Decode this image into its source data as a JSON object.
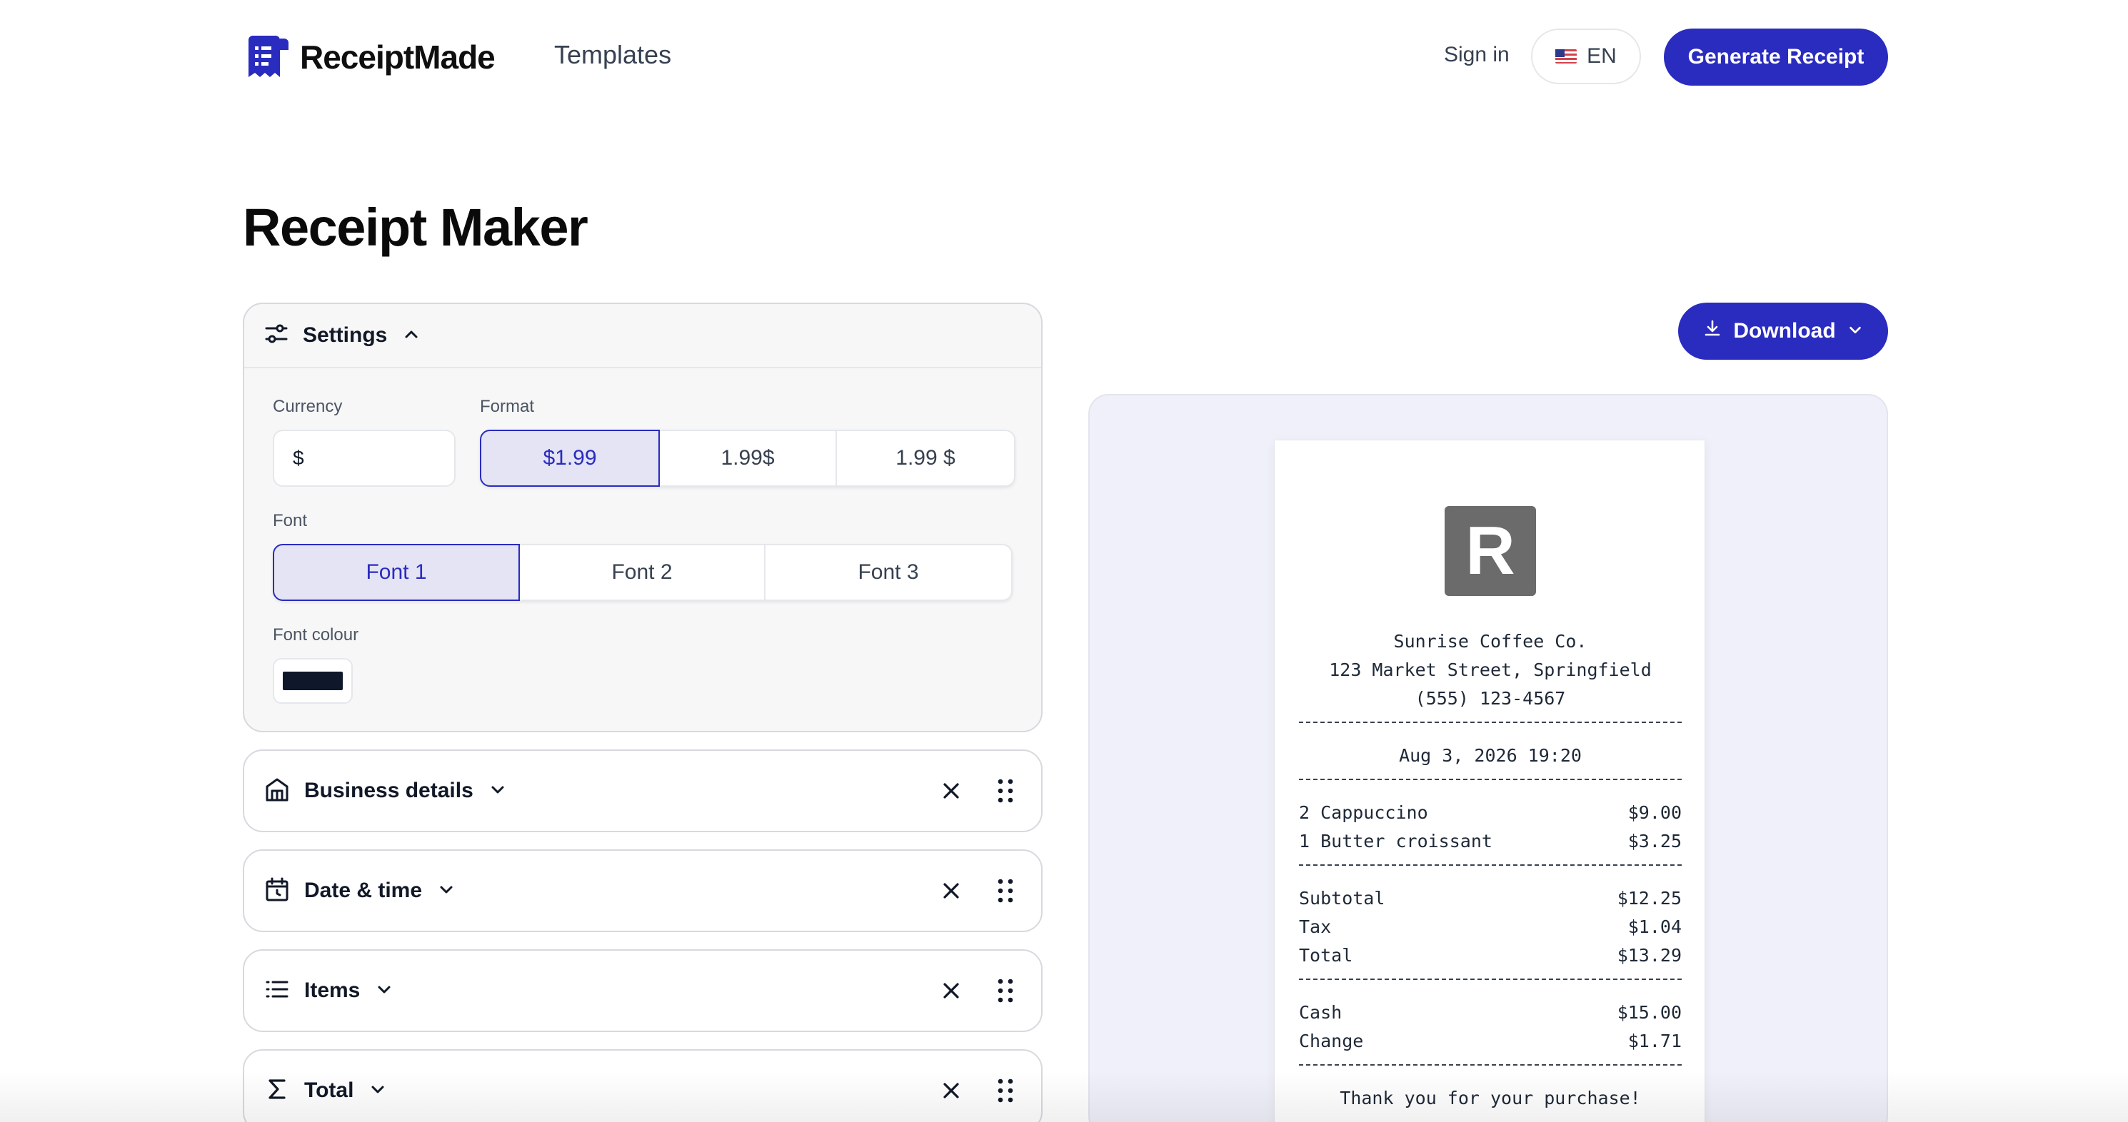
{
  "header": {
    "logo_text": "ReceiptMade",
    "nav_templates": "Templates",
    "sign_in": "Sign in",
    "language": "EN",
    "generate_button": "Generate Receipt"
  },
  "page_title": "Receipt Maker",
  "settings": {
    "title": "Settings",
    "currency_label": "Currency",
    "currency_value": "$",
    "format_label": "Format",
    "format_options": [
      "$1.99",
      "1.99$",
      "1.99 $"
    ],
    "format_selected": "$1.99",
    "font_label": "Font",
    "font_options": [
      "Font 1",
      "Font 2",
      "Font 3"
    ],
    "font_selected": "Font 1",
    "font_colour_label": "Font colour",
    "font_colour": "#0f172a"
  },
  "sections": [
    {
      "label": "Business details",
      "icon": "store-icon"
    },
    {
      "label": "Date & time",
      "icon": "calendar-icon"
    },
    {
      "label": "Items",
      "icon": "list-icon"
    },
    {
      "label": "Total",
      "icon": "sigma-icon"
    }
  ],
  "download_button": "Download",
  "receipt": {
    "logo_letter": "R",
    "business_name": "Sunrise Coffee Co.",
    "address": "123 Market Street, Springfield",
    "phone": "(555) 123-4567",
    "datetime": "Aug 3, 2026 19:20",
    "items": [
      {
        "name": "2 Cappuccino",
        "price": "$9.00"
      },
      {
        "name": "1 Butter croissant",
        "price": "$3.25"
      }
    ],
    "totals": [
      {
        "name": "Subtotal",
        "price": "$12.25"
      },
      {
        "name": "Tax",
        "price": "$1.04"
      },
      {
        "name": "Total",
        "price": "$13.29"
      }
    ],
    "payment": [
      {
        "name": "Cash",
        "price": "$15.00"
      },
      {
        "name": "Change",
        "price": "$1.71"
      }
    ],
    "footer": "Thank you for your purchase!"
  },
  "colors": {
    "accent": "#2a2bbf",
    "selected_bg": "#e4e4f4",
    "preview_bg": "#f0f0fa"
  }
}
